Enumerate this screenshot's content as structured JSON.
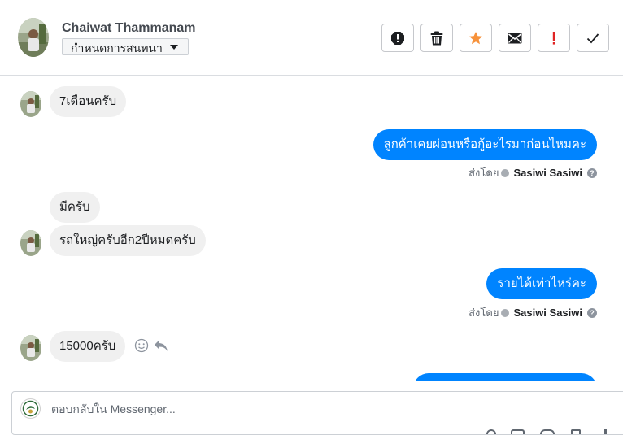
{
  "header": {
    "contact_name": "Chaiwat Thammanam",
    "conversation_status": "กำหนดการสนทนา",
    "toolbar": [
      {
        "name": "spam-button",
        "icon": "alert-octagon-icon"
      },
      {
        "name": "delete-button",
        "icon": "trash-icon"
      },
      {
        "name": "star-button",
        "icon": "star-icon",
        "color": "#f7923b"
      },
      {
        "name": "mark-unread-button",
        "icon": "envelope-icon"
      },
      {
        "name": "follow-up-button",
        "icon": "exclamation-icon",
        "color": "#e02424"
      },
      {
        "name": "mark-done-button",
        "icon": "checkmark-icon"
      }
    ]
  },
  "messages": [
    {
      "direction": "in",
      "text": "7เดือนครับ"
    },
    {
      "direction": "out",
      "text": "ลูกค้าเคยผ่อนหรือกู้อะไรมาก่อนไหมคะ",
      "sent_by_label": "ส่งโดย",
      "sender": "Sasiwi Sasiwi"
    },
    {
      "direction": "in",
      "text": "มีครับ"
    },
    {
      "direction": "in",
      "text": "รถใหญ่ครับอีก2ปีหมดครับ"
    },
    {
      "direction": "out",
      "text": "รายได้เท่าไหร่คะ",
      "sent_by_label": "ส่งโดย",
      "sender": "Sasiwi Sasiwi"
    },
    {
      "direction": "in",
      "text": "15000ครับ"
    }
  ],
  "reply": {
    "placeholder": "ตอบกลับใน Messenger..."
  },
  "colors": {
    "outgoing_bubble": "#0084ff",
    "incoming_bubble": "#f0f0f0"
  }
}
